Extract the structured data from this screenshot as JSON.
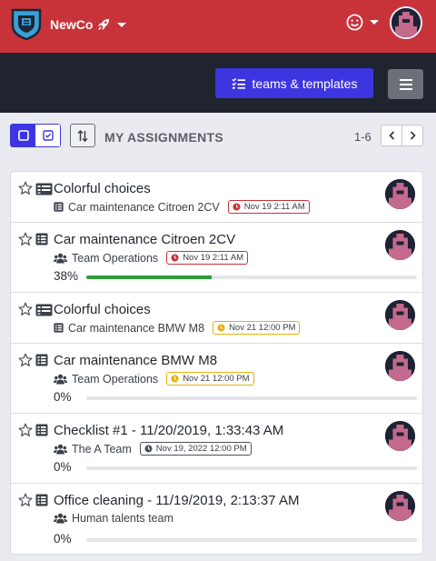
{
  "header": {
    "brand": "NewCo",
    "colors": {
      "topbar": "#c8333a",
      "subbar": "#1f242f",
      "accent": "#3d36e0"
    },
    "icons": [
      "logo-shield-icon",
      "rocket-icon",
      "smile-icon",
      "user-avatar"
    ]
  },
  "subbar": {
    "teams_button_label": "teams & templates",
    "icons": [
      "checklist-icon",
      "hamburger-icon"
    ]
  },
  "toolbar": {
    "heading": "MY ASSIGNMENTS",
    "range": "1-6",
    "icons": [
      "square-icon",
      "check-square-icon",
      "sort-icon",
      "chevron-left-icon",
      "chevron-right-icon"
    ]
  },
  "assignments": [
    {
      "title": "Colorful choices",
      "subtitle": "Car maintenance Citroen 2CV",
      "subtitle_icon": "list-icon",
      "type_icon": "card-list-icon",
      "due": "Nov 19 2:11 AM",
      "due_status": "overdue"
    },
    {
      "title": "Car maintenance Citroen 2CV",
      "subtitle": "Team Operations",
      "subtitle_icon": "users-icon",
      "type_icon": "list-icon",
      "due": "Nov 19 2:11 AM",
      "due_status": "overdue",
      "progress_label": "38%",
      "progress": 0.38
    },
    {
      "title": "Colorful choices",
      "subtitle": "Car maintenance BMW M8",
      "subtitle_icon": "list-icon",
      "type_icon": "card-list-icon",
      "due": "Nov 21 12:00 PM",
      "due_status": "soon"
    },
    {
      "title": "Car maintenance BMW M8",
      "subtitle": "Team Operations",
      "subtitle_icon": "users-icon",
      "type_icon": "list-icon",
      "due": "Nov 21 12:00 PM",
      "due_status": "soon",
      "progress_label": "0%",
      "progress": 0
    },
    {
      "title": "Checklist #1 - 11/20/2019, 1:33:43 AM",
      "subtitle": "The A Team",
      "subtitle_icon": "users-icon",
      "type_icon": "list-icon",
      "due": "Nov 19, 2022 12:00 PM",
      "due_status": "later",
      "progress_label": "0%",
      "progress": 0
    },
    {
      "title": "Office cleaning - 11/19/2019, 2:13:37 AM",
      "subtitle": "Human talents team",
      "subtitle_icon": "users-icon",
      "type_icon": "list-icon",
      "progress_label": "0%",
      "progress": 0
    }
  ]
}
